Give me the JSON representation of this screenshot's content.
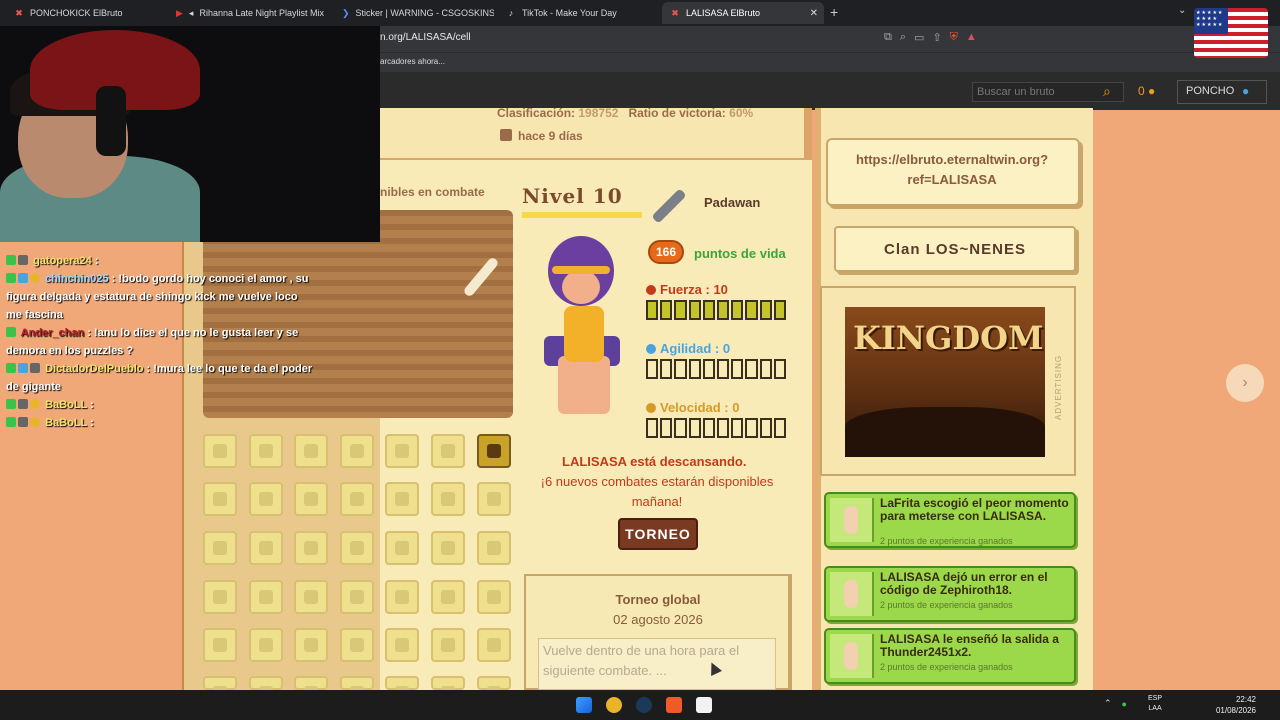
{
  "browser": {
    "tabs": [
      {
        "label": "PONCHOKICK ElBruto",
        "active": false
      },
      {
        "label": "Rihanna Late Night Playlist Mix",
        "active": false
      },
      {
        "label": "Sticker | WARNING - CSGOSKINS.GG",
        "active": false
      },
      {
        "label": "TikTok - Make Your Day",
        "active": false
      },
      {
        "label": "LALISASA ElBruto",
        "active": true
      }
    ],
    "url": "n.org/LALISASA/cell",
    "bookmarks_text": "arcadores ahora..."
  },
  "site_header": {
    "search_placeholder": "Buscar un bruto",
    "gold": "0",
    "user": "PONCHO"
  },
  "chat": [
    {
      "user": "gatopera24",
      "message": "",
      "color": "gold"
    },
    {
      "user": "chinchin025",
      "message": "!bodo gordo hoy conoci el amor , su figura delgada y estatura de shingo kick me vuelve loco me fascina",
      "color": "blue"
    },
    {
      "user": "Ander_chan",
      "message": "!anu lo dice el que no le gusta leer y se demora en los puzzles ?",
      "color": "red"
    },
    {
      "user": "DictadorDelPueblo",
      "message": "!mura lee lo que te da el poder de gigante",
      "color": "gold"
    },
    {
      "user": "BaBoLL",
      "message": "",
      "color": "gold"
    },
    {
      "user": "BaBoLL",
      "message": "",
      "color": "gold"
    }
  ],
  "brute": {
    "classification_label": "Clasificación:",
    "classification_value": "198752",
    "win_ratio_label": "Ratio de victoria:",
    "win_ratio_value": "60%",
    "last_seen": "hace 9 días",
    "available_label": "nibles en combate",
    "level_text": "Nivel 10",
    "level_progress": 1.0,
    "rank": "Padawan",
    "hp": "166",
    "hp_label": "puntos de vida",
    "stats": [
      {
        "label": "Fuerza : 10",
        "value": 10,
        "max": 10,
        "color": "#c23a1a"
      },
      {
        "label": "Agilidad : 0",
        "value": 0,
        "max": 10,
        "color": "#4aa3df"
      },
      {
        "label": "Velocidad : 0",
        "value": 0,
        "max": 10,
        "color": "#d49a2a"
      }
    ],
    "rest_title": "LALISASA está descansando.",
    "rest_sub": "¡6 nuevos combates estarán disponibles mañana!",
    "torneo_button": "TORNEO"
  },
  "tournament": {
    "title": "Torneo global",
    "date": "02 agosto 2026",
    "note": "Vuelve dentro de una hora para el siguiente combate. ..."
  },
  "right": {
    "referral": "https://elbruto.eternaltwin.org?ref=LALISASA",
    "clan": "Clan LOS~NENES",
    "ad_title": "KINGDOM",
    "ad_label": "ADVERTISING",
    "feed": [
      {
        "title": "LaFrita escogió el peor momento para meterse con LALISASA.",
        "sub": "2 puntos de experiencia ganados"
      },
      {
        "title": "LALISASA dejó un error en el código de Zephiroth18.",
        "sub": "2 puntos de experiencia ganados"
      },
      {
        "title": "LALISASA le enseñó la salida a Thunder2451x2.",
        "sub": "2 puntos de experiencia ganados"
      }
    ]
  },
  "taskbar": {
    "lang_top": "ESP",
    "lang_bottom": "LAA",
    "time": "22:42",
    "date": "01/08/2026"
  }
}
